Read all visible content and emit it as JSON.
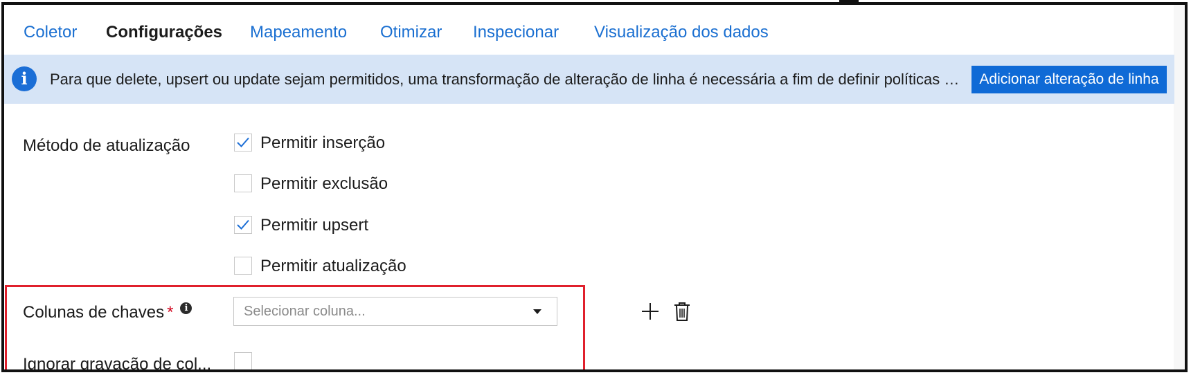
{
  "tabs": [
    {
      "label": "Coletor",
      "active": false
    },
    {
      "label": "Configurações",
      "active": true
    },
    {
      "label": "Mapeamento",
      "active": false
    },
    {
      "label": "Otimizar",
      "active": false
    },
    {
      "label": "Inspecionar",
      "active": false
    },
    {
      "label": "Visualização dos dados",
      "active": false
    }
  ],
  "banner": {
    "icon": "info-icon",
    "text": "Para que delete, upsert ou update sejam permitidos, uma transformação de alteração de linha é necessária a fim de definir políticas de linha",
    "button_label": "Adicionar alteração de linha",
    "background_color": "#d6e4f6",
    "button_color": "#0f6ad6"
  },
  "update_method": {
    "label": "Método de atualização",
    "options": [
      {
        "label": "Permitir inserção",
        "checked": true
      },
      {
        "label": "Permitir exclusão",
        "checked": false
      },
      {
        "label": "Permitir upsert",
        "checked": true
      },
      {
        "label": "Permitir atualização",
        "checked": false
      }
    ]
  },
  "key_columns": {
    "label": "Colunas de chaves",
    "required_mark": "*",
    "info_icon": "i",
    "placeholder": "Selecionar coluna...",
    "add_icon": "plus-icon",
    "delete_icon": "trash-icon"
  },
  "skip_writing": {
    "label": "Ignorar gravação de col...",
    "checked": false
  },
  "colors": {
    "accent": "#1a6fd1",
    "highlight": "#e0202c"
  }
}
